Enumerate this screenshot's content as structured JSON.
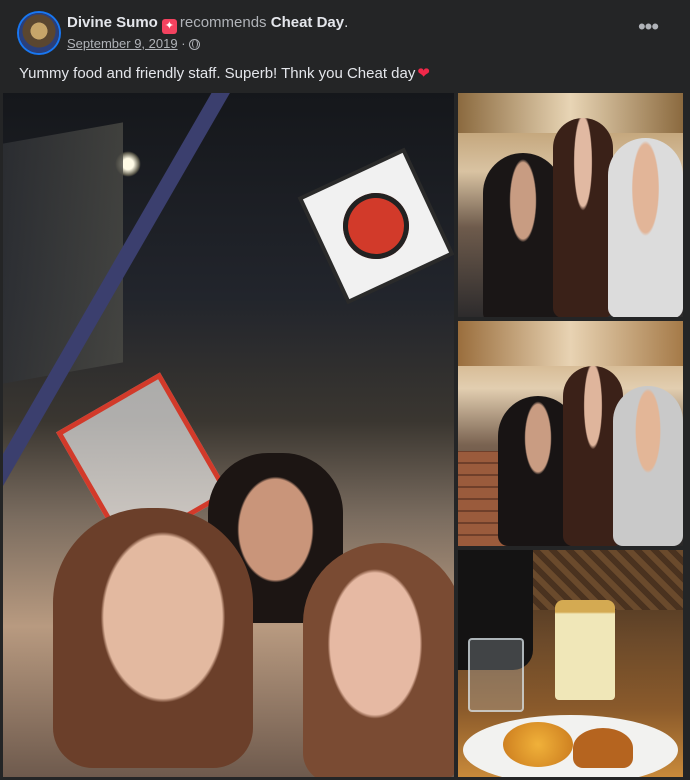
{
  "post": {
    "author": "Divine Sumo",
    "verb": "recommends",
    "page": "Cheat Day",
    "punct": ".",
    "date": "September 9, 2019",
    "separator": "·",
    "more_label": "•••",
    "text": "Yummy food and friendly staff. Superb! Thnk you Cheat day",
    "heart": "❤"
  },
  "icons": {
    "recommend": "recommend-badge-icon",
    "privacy": "globe-icon",
    "more": "more-options-icon",
    "heart": "heart-icon"
  },
  "colors": {
    "background": "#242526",
    "text": "#e4e6eb",
    "secondary": "#b0b3b8",
    "badge": "#f3425f",
    "heart": "#f02849"
  },
  "photos": [
    {
      "name": "street-selfie-photo"
    },
    {
      "name": "restaurant-group-photo-1"
    },
    {
      "name": "restaurant-group-photo-2"
    },
    {
      "name": "food-and-drink-photo"
    }
  ]
}
